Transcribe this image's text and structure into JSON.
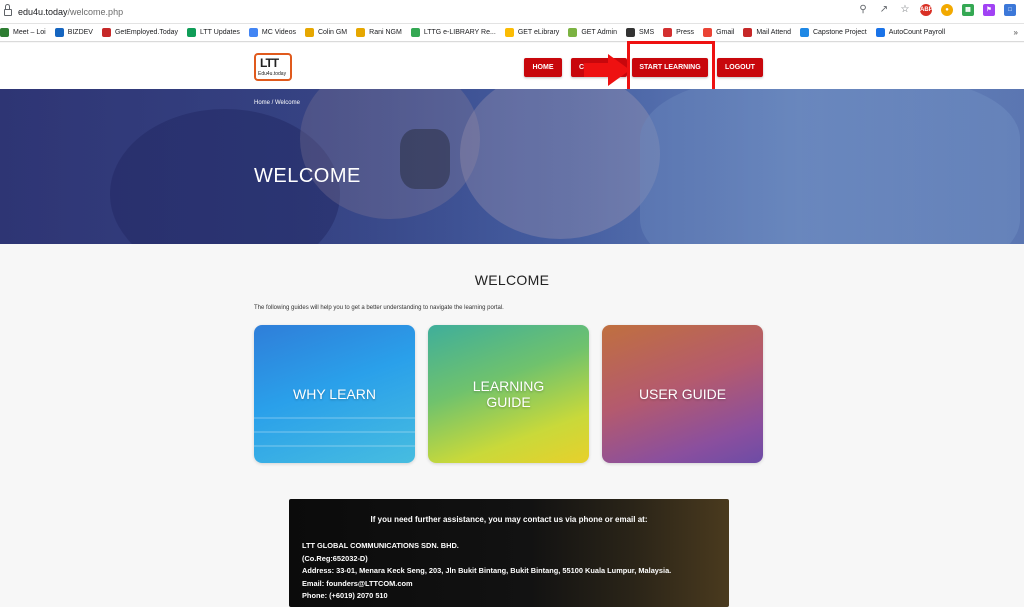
{
  "browser": {
    "url_host": "edu4u.today",
    "url_path": "/welcome.php",
    "bookmarks": [
      {
        "label": "Meet – Loi",
        "icon": "meet-icon",
        "color": "#2e7d32"
      },
      {
        "label": "BIZDEV",
        "icon": "bizdev-icon",
        "color": "#1565c0"
      },
      {
        "label": "GetEmployed.Today",
        "icon": "getemployed-icon",
        "color": "#c62828"
      },
      {
        "label": "LTT Updates",
        "icon": "ltt-updates-icon",
        "color": "#0f9d58"
      },
      {
        "label": "MC Videos",
        "icon": "google-icon",
        "color": "#4285f4"
      },
      {
        "label": "Colin GM",
        "icon": "folder-icon",
        "color": "#e6a700"
      },
      {
        "label": "Rani NGM",
        "icon": "folder-icon",
        "color": "#e6a700"
      },
      {
        "label": "LTTG e-LIBRARY Re...",
        "icon": "drive-icon",
        "color": "#34a853"
      },
      {
        "label": "GET eLibrary",
        "icon": "drive-icon",
        "color": "#fbbc04"
      },
      {
        "label": "GET Admin",
        "icon": "get-admin-icon",
        "color": "#7cb342"
      },
      {
        "label": "SMS",
        "icon": "globe-icon",
        "color": "#333333"
      },
      {
        "label": "Press",
        "icon": "press-icon",
        "color": "#d32f2f"
      },
      {
        "label": "Gmail",
        "icon": "gmail-icon",
        "color": "#ea4335"
      },
      {
        "label": "Mail Attend",
        "icon": "mail-attend-icon",
        "color": "#c62828"
      },
      {
        "label": "Capstone Project",
        "icon": "capstone-icon",
        "color": "#1e88e5"
      },
      {
        "label": "AutoCount Payroll",
        "icon": "autocount-icon",
        "color": "#1a73e8"
      }
    ],
    "more_label": "»"
  },
  "site": {
    "logo_main": "LTT",
    "logo_sub": "Edu4u.today",
    "nav": {
      "home": "HOME",
      "second": "C",
      "start_learning": "START LEARNING",
      "logout": "LOGOUT"
    }
  },
  "hero": {
    "breadcrumb": "Home /  Welcome",
    "title": "WELCOME"
  },
  "content": {
    "title": "WELCOME",
    "intro": "The following guides will help you to get a better understanding to navigate the learning portal.",
    "cards": [
      {
        "label": "WHY LEARN"
      },
      {
        "label": "LEARNING GUIDE"
      },
      {
        "label": "USER GUIDE"
      }
    ]
  },
  "contact": {
    "heading": "If you need further assistance, you may contact us via phone or email at:",
    "company": "LTT GLOBAL COMMUNICATIONS SDN. BHD.",
    "reg": "(Co.Reg:652032-D)",
    "address": "Address: 33-01, Menara Keck Seng, 203, Jln Bukit Bintang, Bukit Bintang, 55100 Kuala Lumpur, Malaysia.",
    "email": "Email: founders@LTTCOM.com",
    "phone": "Phone: (+6019) 2070 510"
  },
  "colors": {
    "brand_red": "#c8070c",
    "annotation_red": "#ee1111"
  }
}
